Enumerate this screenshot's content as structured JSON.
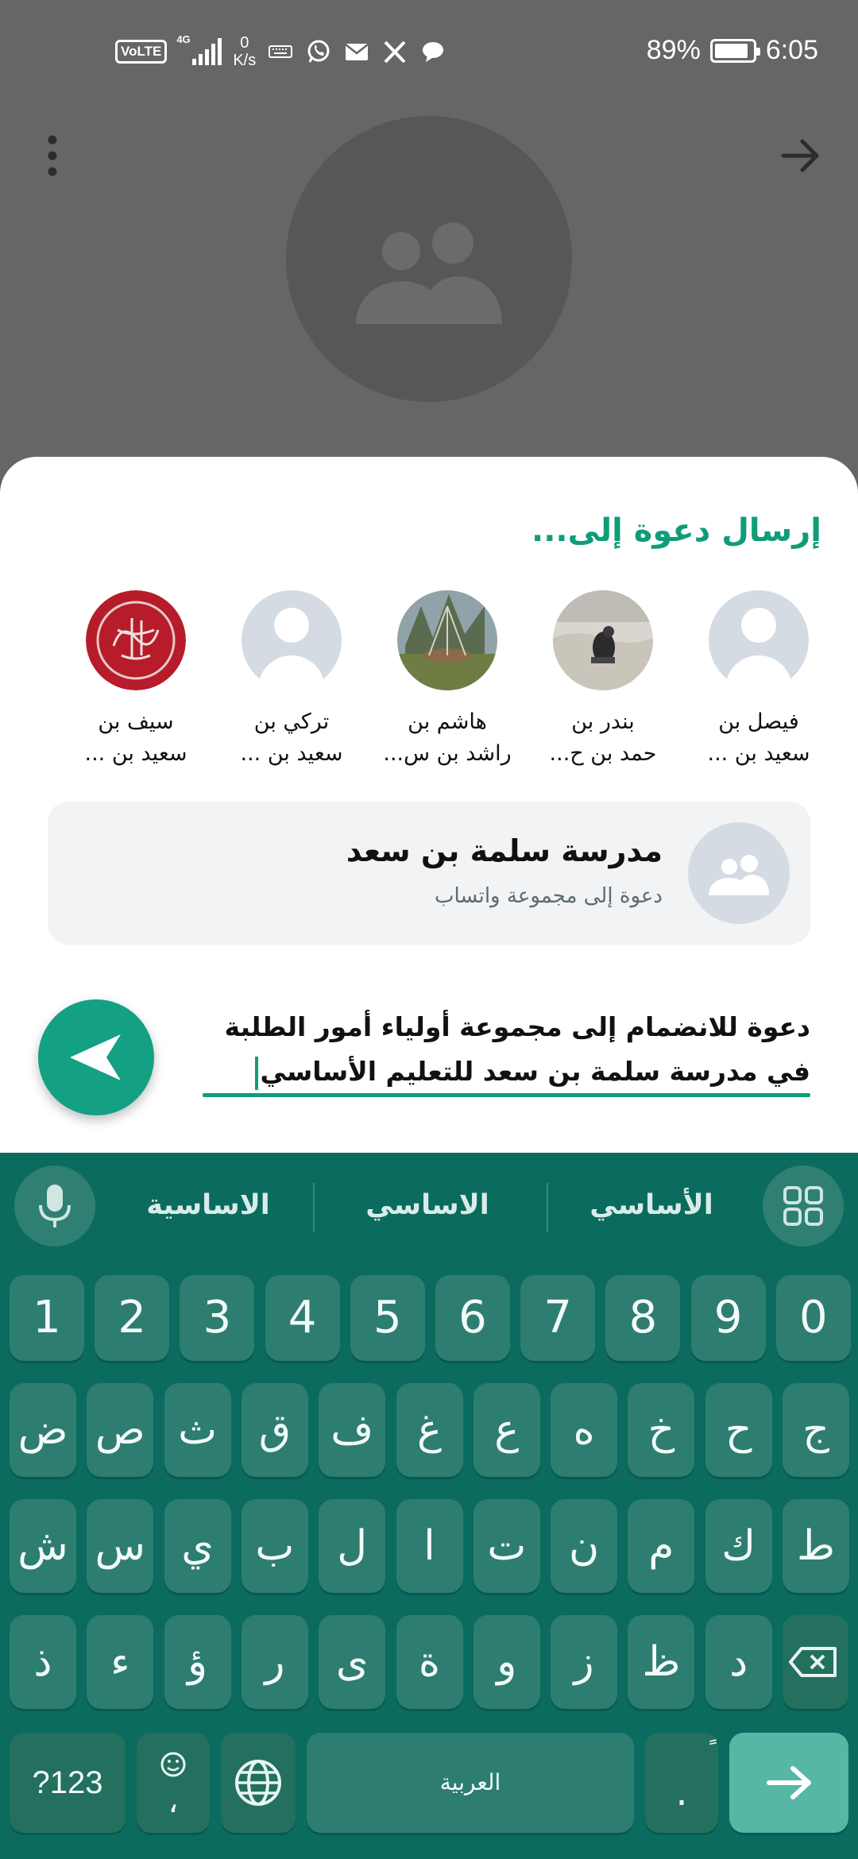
{
  "status_bar": {
    "volte": "VoLTE",
    "network": "4G",
    "speed_value": "0",
    "speed_unit": "K/s",
    "battery": "89%",
    "battery_level": 0.89,
    "time": "6:05",
    "icons": [
      "keyboard-icon",
      "whatsapp-icon",
      "mail-icon",
      "x-icon",
      "chat-icon"
    ]
  },
  "sheet": {
    "title": "إرسال دعوة إلى...",
    "contacts": [
      {
        "line1": "فيصل بن",
        "line2": "سعيد بن ..."
      },
      {
        "line1": "بندر بن",
        "line2": "حمد بن ح..."
      },
      {
        "line1": "هاشم بن",
        "line2": "راشد بن س..."
      },
      {
        "line1": "تركي بن",
        "line2": "سعيد بن ..."
      },
      {
        "line1": "سيف بن",
        "line2": "سعيد بن ..."
      }
    ],
    "group": {
      "name": "مدرسة سلمة بن سعد",
      "subtitle": "دعوة إلى مجموعة واتساب"
    },
    "message": {
      "line1": "دعوة للانضمام إلى مجموعة أولياء أمور الطلبة",
      "line2": "في مدرسة سلمة بن سعد للتعليم الأساسي"
    }
  },
  "keyboard": {
    "suggestions": [
      "الأساسي",
      "الاساسي",
      "الاساسية"
    ],
    "numbers": [
      "1",
      "2",
      "3",
      "4",
      "5",
      "6",
      "7",
      "8",
      "9",
      "0"
    ],
    "row1": [
      "ض",
      "ص",
      "ث",
      "ق",
      "ف",
      "غ",
      "ع",
      "ه",
      "خ",
      "ح",
      "ج"
    ],
    "row2": [
      "ش",
      "س",
      "ي",
      "ب",
      "ل",
      "ا",
      "ت",
      "ن",
      "م",
      "ك",
      "ط"
    ],
    "row3": [
      "ذ",
      "ء",
      "ؤ",
      "ر",
      "ى",
      "ة",
      "و",
      "ز",
      "ظ",
      "د"
    ],
    "symbols_key": "?123",
    "comma_key": "،",
    "space_label": "العربية",
    "period_key": ".",
    "period_sub": "ً"
  },
  "colors": {
    "accent": "#0f9d79",
    "keyboard_bg": "#0a6b5e",
    "key_bg": "#2e7d71"
  }
}
